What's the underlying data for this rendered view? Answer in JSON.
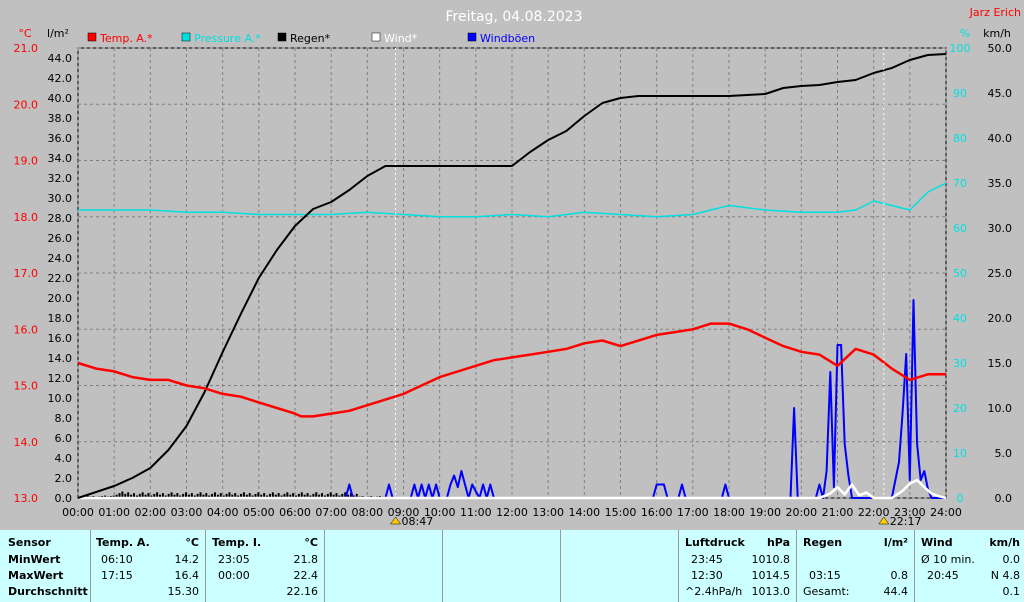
{
  "title": "Freitag, 04.08.2023",
  "author": "Jarz Erich",
  "colors": {
    "background": "#c0c0c0",
    "plot_bg": "#c0c0c0",
    "grid": "#808080",
    "temp": "#ff0000",
    "temp_axis": "#ff0000",
    "pressure": "#00e0e0",
    "rain": "#000000",
    "wind": "#ffffff",
    "gust": "#0000ff",
    "stats_bg": "#ccffff"
  },
  "chart_data": {
    "type": "line",
    "title": "Freitag, 04.08.2023",
    "legend": {
      "placement": "top",
      "items": [
        {
          "label": "Temp. A.*",
          "color": "#ff0000"
        },
        {
          "label": "Pressure A.*",
          "color": "#00e0e0"
        },
        {
          "label": "Regen*",
          "color": "#000000"
        },
        {
          "label": "Wind*",
          "color": "#ffffff"
        },
        {
          "label": "Windböen",
          "color": "#0000ff"
        }
      ]
    },
    "axes": {
      "temp": {
        "unit": "°C",
        "ylim": [
          13.0,
          21.0
        ],
        "ticks": [
          "13.0",
          "14.0",
          "15.0",
          "16.0",
          "17.0",
          "18.0",
          "19.0",
          "20.0",
          "21.0"
        ]
      },
      "rain": {
        "unit": "l/m²",
        "ylim": [
          0,
          45
        ],
        "ticks": [
          "0.0",
          "2.0",
          "4.0",
          "6.0",
          "8.0",
          "10.0",
          "12.0",
          "14.0",
          "16.0",
          "18.0",
          "20.0",
          "22.0",
          "24.0",
          "26.0",
          "28.0",
          "30.0",
          "32.0",
          "34.0",
          "36.0",
          "38.0",
          "40.0",
          "42.0",
          "44.0"
        ]
      },
      "humidity": {
        "unit": "%",
        "ylim": [
          0,
          100
        ],
        "ticks": [
          "0",
          "10",
          "20",
          "30",
          "40",
          "50",
          "60",
          "70",
          "80",
          "90",
          "100"
        ]
      },
      "wind": {
        "unit": "km/h",
        "ylim": [
          0,
          50
        ],
        "ticks": [
          "0.0",
          "5.0",
          "10.0",
          "15.0",
          "20.0",
          "25.0",
          "30.0",
          "35.0",
          "40.0",
          "45.0",
          "50.0"
        ]
      },
      "x": {
        "xlim": [
          0,
          24
        ],
        "ticks": [
          "00:00",
          "01:00",
          "02:00",
          "03:00",
          "04:00",
          "05:00",
          "06:00",
          "07:00",
          "08:00",
          "09:00",
          "10:00",
          "11:00",
          "12:00",
          "13:00",
          "14:00",
          "15:00",
          "16:00",
          "17:00",
          "18:00",
          "19:00",
          "20:00",
          "21:00",
          "22:00",
          "23:00",
          "24:00"
        ]
      }
    },
    "markers": [
      {
        "label": "08:47",
        "x": 8.78,
        "symbol": "sunrise"
      },
      {
        "label": "22:17",
        "x": 22.28,
        "symbol": "sunset"
      }
    ],
    "series": [
      {
        "name": "Temp. A.*",
        "axis": "temp",
        "color": "#ff0000",
        "x": [
          0,
          0.5,
          1,
          1.5,
          2,
          2.5,
          3,
          3.5,
          4,
          4.5,
          5,
          5.5,
          6,
          6.17,
          6.5,
          7,
          7.5,
          8,
          8.5,
          9,
          9.5,
          10,
          10.5,
          11,
          11.5,
          12,
          12.5,
          13,
          13.5,
          14,
          14.5,
          15,
          15.5,
          16,
          16.5,
          17,
          17.25,
          17.5,
          18,
          18.5,
          19,
          19.5,
          20,
          20.5,
          21,
          21.5,
          22,
          22.5,
          23,
          23.5,
          24
        ],
        "y": [
          15.4,
          15.3,
          15.25,
          15.15,
          15.1,
          15.1,
          15.0,
          14.95,
          14.85,
          14.8,
          14.7,
          14.6,
          14.5,
          14.45,
          14.45,
          14.5,
          14.55,
          14.65,
          14.75,
          14.85,
          15.0,
          15.15,
          15.25,
          15.35,
          15.45,
          15.5,
          15.55,
          15.6,
          15.65,
          15.75,
          15.8,
          15.7,
          15.8,
          15.9,
          15.95,
          16.0,
          16.05,
          16.1,
          16.1,
          16.0,
          15.85,
          15.7,
          15.6,
          15.55,
          15.35,
          15.65,
          15.55,
          15.3,
          15.1,
          15.2,
          15.2
        ]
      },
      {
        "name": "Pressure A.*",
        "axis": "humidity",
        "color": "#00e0e0",
        "x": [
          0,
          1,
          2,
          3,
          4,
          5,
          6,
          7,
          8,
          9,
          10,
          11,
          12,
          13,
          14,
          15,
          16,
          17,
          18,
          19,
          20,
          21,
          21.5,
          22,
          22.5,
          23,
          23.5,
          24
        ],
        "y": [
          64,
          64,
          64,
          63.5,
          63.5,
          63,
          63,
          63,
          63.5,
          63,
          62.5,
          62.5,
          63,
          62.5,
          63.5,
          63,
          62.5,
          63,
          65,
          64,
          63.5,
          63.5,
          64,
          66,
          65,
          64,
          68,
          70
        ]
      },
      {
        "name": "Regen*",
        "axis": "rain",
        "color": "#000000",
        "x": [
          0,
          0.5,
          1,
          1.5,
          2,
          2.5,
          3,
          3.5,
          4,
          4.5,
          5,
          5.5,
          6,
          6.5,
          7,
          7.5,
          8,
          8.5,
          9,
          9.5,
          10,
          10.5,
          11,
          11.5,
          12,
          12.5,
          13,
          13.5,
          14,
          14.5,
          15,
          15.5,
          16,
          16.5,
          17,
          17.5,
          18,
          18.5,
          19,
          19.5,
          20,
          20.5,
          21,
          21.5,
          22,
          22.5,
          23,
          23.5,
          24
        ],
        "y": [
          0,
          0.6,
          1.2,
          2,
          3,
          4.8,
          7.2,
          10.6,
          14.6,
          18.4,
          22,
          24.8,
          27.2,
          28.9,
          29.6,
          30.8,
          32.2,
          33.2,
          33.2,
          33.2,
          33.2,
          33.2,
          33.2,
          33.2,
          33.2,
          34.6,
          35.8,
          36.7,
          38.2,
          39.5,
          40.0,
          40.2,
          40.2,
          40.2,
          40.2,
          40.2,
          40.2,
          40.3,
          40.4,
          41.0,
          41.2,
          41.3,
          41.6,
          41.8,
          42.5,
          43.0,
          43.8,
          44.3,
          44.4
        ]
      },
      {
        "name": "Wind*",
        "axis": "wind",
        "color": "#ffffff",
        "x": [
          0,
          20.5,
          20.8,
          21.0,
          21.2,
          21.4,
          21.6,
          21.8,
          22.0,
          22.5,
          22.8,
          23.0,
          23.2,
          23.4,
          23.6,
          23.8,
          24
        ],
        "y": [
          0,
          0,
          0.5,
          1.2,
          0.4,
          1.5,
          0.3,
          0.6,
          0,
          0,
          0.8,
          1.6,
          2.0,
          1.2,
          0.5,
          0.2,
          0
        ]
      },
      {
        "name": "Windböen",
        "axis": "wind",
        "color": "#0000ff",
        "x": [
          0,
          7.4,
          7.5,
          7.6,
          8.5,
          8.6,
          8.7,
          9.2,
          9.3,
          9.4,
          9.5,
          9.6,
          9.7,
          9.8,
          9.9,
          10.0,
          10.2,
          10.3,
          10.4,
          10.5,
          10.6,
          10.7,
          10.8,
          10.9,
          11.1,
          11.2,
          11.3,
          11.4,
          11.5,
          11.6,
          12,
          15.9,
          16.0,
          16.1,
          16.2,
          16.3,
          16.6,
          16.7,
          16.8,
          17.8,
          17.9,
          18.0,
          19.7,
          19.8,
          19.9,
          20.4,
          20.5,
          20.6,
          20.7,
          20.8,
          20.9,
          21.0,
          21.1,
          21.2,
          21.3,
          21.4,
          21.5,
          22.5,
          22.7,
          22.8,
          22.9,
          23.0,
          23.1,
          23.2,
          23.3,
          23.4,
          23.5,
          23.6,
          23.7,
          23.8,
          23.9,
          24
        ],
        "y": [
          0,
          0,
          1.5,
          0,
          0,
          1.5,
          0,
          0,
          1.5,
          0,
          1.5,
          0,
          1.5,
          0,
          1.5,
          0,
          0,
          1.5,
          2.5,
          1.2,
          3.0,
          1.5,
          0,
          1.5,
          0,
          1.5,
          0,
          1.5,
          0,
          0,
          0,
          0,
          1.5,
          1.5,
          1.5,
          0,
          0,
          1.5,
          0,
          0,
          1.5,
          0,
          0,
          10.0,
          0,
          0,
          1.5,
          0,
          3.0,
          14.0,
          1.2,
          17.0,
          17.0,
          6.0,
          2.5,
          0,
          0,
          0,
          4.0,
          9.5,
          16.0,
          2.0,
          22.0,
          6.0,
          2.0,
          3.0,
          1.0,
          0,
          0,
          0,
          0,
          0
        ]
      }
    ]
  },
  "stats": {
    "sensor": {
      "header": "Sensor",
      "min": "MinWert",
      "max": "MaxWert",
      "avg": "Durchschnitt"
    },
    "temp_a": {
      "header": "Temp. A.",
      "unit": "°C",
      "min_time": "06:10",
      "min_val": "14.2",
      "max_time": "17:15",
      "max_val": "16.4",
      "avg": "15.30"
    },
    "temp_i": {
      "header": "Temp. I.",
      "unit": "°C",
      "min_time": "23:05",
      "min_val": "21.8",
      "max_time": "00:00",
      "max_val": "22.4",
      "avg": "22.16"
    },
    "pressure": {
      "header": "Luftdruck",
      "unit": "hPa",
      "min_time": "23:45",
      "min_val": "1010.8",
      "max_time": "12:30",
      "max_val": "1014.5",
      "trend_label": "^2.4hPa/h",
      "trend_val": "1013.0"
    },
    "rain": {
      "header": "Regen",
      "unit": "l/m²",
      "max_time": "03:15",
      "max_val": "0.8",
      "total_label": "Gesamt:",
      "total_val": "44.4"
    },
    "wind": {
      "header": "Wind",
      "unit": "km/h",
      "avg_label": "Ø 10 min.",
      "avg_val": "0.0",
      "max_time": "20:45",
      "max_val": "N 4.8",
      "mean_val": "0.1"
    }
  }
}
